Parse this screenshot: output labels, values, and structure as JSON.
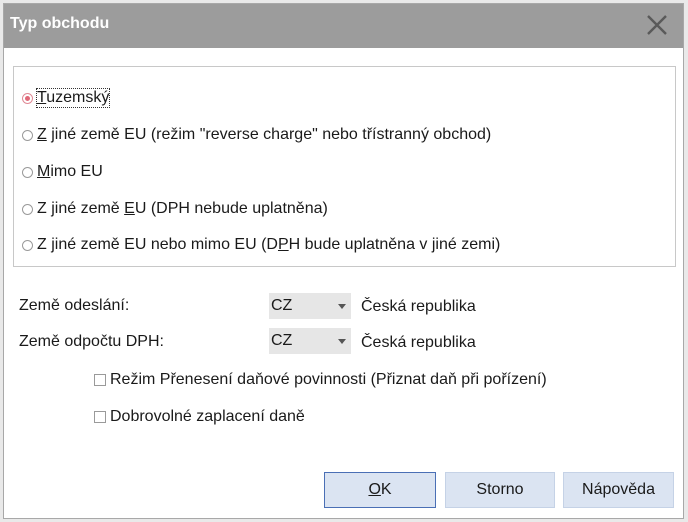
{
  "dialog": {
    "title": "Typ obchodu"
  },
  "trade_type": {
    "options": [
      {
        "pre": "",
        "key": "T",
        "post": "uzemský",
        "checked": true
      },
      {
        "pre": "",
        "key": "Z",
        "post": " jiné země EU (režim \"reverse charge\" nebo třístranný obchod)",
        "checked": false
      },
      {
        "pre": "",
        "key": "M",
        "post": "imo EU",
        "checked": false
      },
      {
        "pre": "Z jiné země ",
        "key": "E",
        "post": "U (DPH nebude uplatněna)",
        "checked": false
      },
      {
        "pre": "Z jiné země EU nebo mimo EU (D",
        "key": "P",
        "post": "H bude uplatněna v jiné zemi)",
        "checked": false
      }
    ]
  },
  "fields": {
    "origin_label": "Země odeslání:",
    "origin_code": "CZ",
    "origin_name": "Česká republika",
    "vat_label": "Země odpočtu DPH:",
    "vat_code": "CZ",
    "vat_name": "Česká republika"
  },
  "checks": {
    "reverse_charge": "Režim Přenesení daňové povinnosti (Přiznat daň při pořízení)",
    "voluntary_tax": "Dobrovolné zaplacení daně"
  },
  "buttons": {
    "ok_key": "O",
    "ok_rest": "K",
    "cancel": "Storno",
    "help": "Nápověda"
  },
  "colors": {
    "titlebar": "#9c9c9c",
    "button_bg": "#dbe4f2",
    "default_border": "#4a6fb5",
    "radio_selected": "#e06878"
  }
}
